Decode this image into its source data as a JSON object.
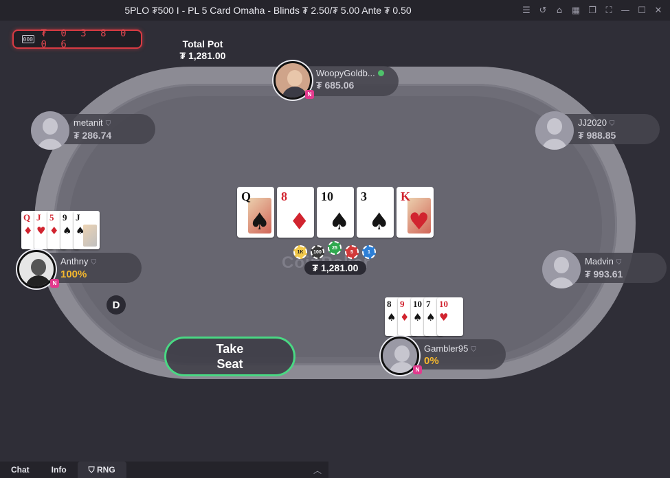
{
  "window": {
    "title": "5PLO ₮500 I - PL 5 Card Omaha - Blinds ₮ 2.50/₮ 5.00 Ante ₮ 0.50",
    "controls": [
      "list-icon",
      "history-icon",
      "lobby-icon",
      "grid-icon",
      "cascade-icon",
      "fullscreen-icon",
      "minimize-icon",
      "maximize-icon",
      "close-icon"
    ]
  },
  "odometer": {
    "icon_text": "000",
    "value": "₮ 0 3 8 0 0 6"
  },
  "pot": {
    "label": "Total Pot",
    "total": "₮ 1,281.00",
    "center": "₮ 1,281.00"
  },
  "board": [
    {
      "rank": "Q",
      "suit": "♠",
      "color": "blk",
      "face": true
    },
    {
      "rank": "8",
      "suit": "♦",
      "color": "red",
      "face": false
    },
    {
      "rank": "10",
      "suit": "♠",
      "color": "blk",
      "face": false
    },
    {
      "rank": "3",
      "suit": "♠",
      "color": "blk",
      "face": false
    },
    {
      "rank": "K",
      "suit": "♥",
      "color": "red",
      "face": true
    }
  ],
  "chips": [
    {
      "label": "1K",
      "color": "#f1c84b"
    },
    {
      "label": "100",
      "color": "#3a3a3a"
    },
    {
      "label": "25",
      "color": "#2fa84f"
    },
    {
      "label": "5",
      "color": "#d23a3a"
    },
    {
      "label": "1",
      "color": "#2d7fd6"
    }
  ],
  "logo": "CoinPoker",
  "players": {
    "top": {
      "name": "WoopyGoldb...",
      "stack": "₮ 685.06",
      "badge": "N"
    },
    "left_top": {
      "name": "metanit",
      "stack": "₮ 286.74"
    },
    "right_top": {
      "name": "JJ2020",
      "stack": "₮ 988.85"
    },
    "left": {
      "name": "Anthny",
      "stack": "100%",
      "badge": "N",
      "cards": [
        {
          "rank": "Q",
          "suit": "♦",
          "color": "red"
        },
        {
          "rank": "J",
          "suit": "♥",
          "color": "red"
        },
        {
          "rank": "5",
          "suit": "♦",
          "color": "red"
        },
        {
          "rank": "9",
          "suit": "♠",
          "color": "blk"
        },
        {
          "rank": "J",
          "suit": "♠",
          "color": "blk"
        }
      ]
    },
    "right": {
      "name": "Madvin",
      "stack": "₮ 993.61"
    },
    "hero": {
      "name": "Gambler95",
      "stack": "0%",
      "badge": "N",
      "cards": [
        {
          "rank": "8",
          "suit": "♠",
          "color": "blk"
        },
        {
          "rank": "9",
          "suit": "♦",
          "color": "red"
        },
        {
          "rank": "10",
          "suit": "♠",
          "color": "blk"
        },
        {
          "rank": "7",
          "suit": "♠",
          "color": "blk"
        },
        {
          "rank": "10",
          "suit": "♥",
          "color": "red"
        }
      ]
    }
  },
  "dealer_button": "D",
  "take_seat": "Take Seat",
  "bottom_tabs": [
    "Chat",
    "Info",
    "RNG"
  ]
}
